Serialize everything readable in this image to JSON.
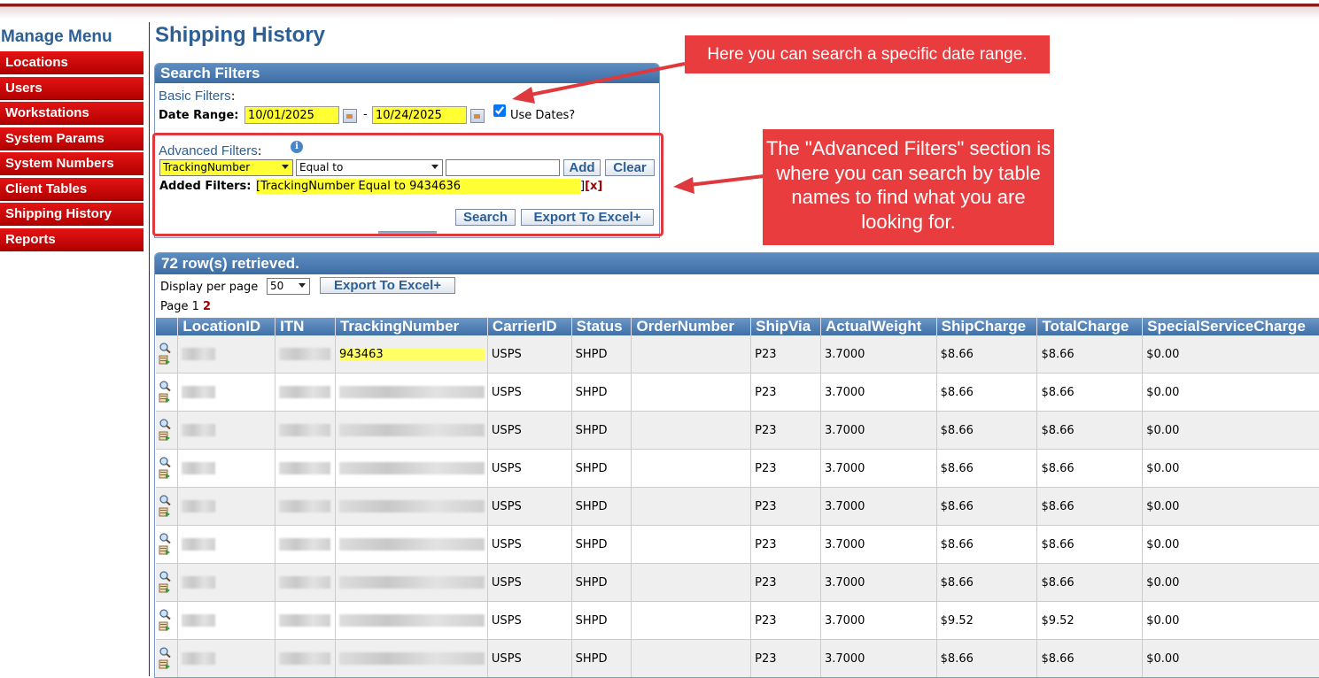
{
  "sidebar": {
    "title": "Manage Menu",
    "items": [
      {
        "label": "Locations"
      },
      {
        "label": "Users"
      },
      {
        "label": "Workstations"
      },
      {
        "label": "System Params"
      },
      {
        "label": "System Numbers"
      },
      {
        "label": "Client Tables"
      },
      {
        "label": "Shipping History"
      },
      {
        "label": "Reports"
      }
    ]
  },
  "page": {
    "title": "Shipping History"
  },
  "filters": {
    "header": "Search Filters",
    "basic_label": "Basic Filters",
    "colon": ":",
    "date_range_label": "Date Range:",
    "date_from": "10/01/2025",
    "date_sep": "-",
    "date_to": "10/24/2025",
    "use_dates_label": "Use Dates?",
    "use_dates_checked": true,
    "advanced_label": "Advanced Filters",
    "field_select": "TrackingNumber",
    "operator_select": "Equal to",
    "value_input": "",
    "add_label": "Add",
    "clear_label": "Clear",
    "added_filters_label": "Added Filters:",
    "added_filter_text": "[TrackingNumber Equal to 9434636",
    "added_filter_close": "]",
    "remove_label": "[x]",
    "search_label": "Search",
    "export_label": "Export To Excel+"
  },
  "callouts": {
    "date_range": "Here you can search a specific date range.",
    "advanced": "The \"Advanced Filters\" section is where you can search by table names to find what you are looking for."
  },
  "results": {
    "header": "72 row(s) retrieved.",
    "display_per_page_label": "Display per page",
    "per_page_value": "50",
    "export_label": "Export To Excel+",
    "page_label": "Page",
    "pages": [
      "1",
      "2"
    ],
    "columns": [
      "LocationID",
      "ITN",
      "TrackingNumber",
      "CarrierID",
      "Status",
      "OrderNumber",
      "ShipVia",
      "ActualWeight",
      "ShipCharge",
      "TotalCharge",
      "SpecialServiceCharge"
    ],
    "rows": [
      {
        "tracking": "943463",
        "carrier": "USPS",
        "status": "SHPD",
        "order": "",
        "shipvia": "P23",
        "weight": "3.7000",
        "ship": "$8.66",
        "total": "$8.66",
        "special": "$0.00"
      },
      {
        "tracking": "",
        "carrier": "USPS",
        "status": "SHPD",
        "order": "",
        "shipvia": "P23",
        "weight": "3.7000",
        "ship": "$8.66",
        "total": "$8.66",
        "special": "$0.00"
      },
      {
        "tracking": "",
        "carrier": "USPS",
        "status": "SHPD",
        "order": "",
        "shipvia": "P23",
        "weight": "3.7000",
        "ship": "$8.66",
        "total": "$8.66",
        "special": "$0.00"
      },
      {
        "tracking": "",
        "carrier": "USPS",
        "status": "SHPD",
        "order": "",
        "shipvia": "P23",
        "weight": "3.7000",
        "ship": "$8.66",
        "total": "$8.66",
        "special": "$0.00"
      },
      {
        "tracking": "",
        "carrier": "USPS",
        "status": "SHPD",
        "order": "",
        "shipvia": "P23",
        "weight": "3.7000",
        "ship": "$8.66",
        "total": "$8.66",
        "special": "$0.00"
      },
      {
        "tracking": "",
        "carrier": "USPS",
        "status": "SHPD",
        "order": "",
        "shipvia": "P23",
        "weight": "3.7000",
        "ship": "$8.66",
        "total": "$8.66",
        "special": "$0.00"
      },
      {
        "tracking": "",
        "carrier": "USPS",
        "status": "SHPD",
        "order": "",
        "shipvia": "P23",
        "weight": "3.7000",
        "ship": "$8.66",
        "total": "$8.66",
        "special": "$0.00"
      },
      {
        "tracking": "",
        "carrier": "USPS",
        "status": "SHPD",
        "order": "",
        "shipvia": "P23",
        "weight": "3.7000",
        "ship": "$9.52",
        "total": "$9.52",
        "special": "$0.00"
      },
      {
        "tracking": "",
        "carrier": "USPS",
        "status": "SHPD",
        "order": "",
        "shipvia": "P23",
        "weight": "3.7000",
        "ship": "$8.66",
        "total": "$8.66",
        "special": "$0.00"
      }
    ]
  },
  "icons": {
    "view": "magnifier-icon",
    "detail": "record-arrow-icon",
    "info": "info-icon",
    "calendar": "calendar-icon"
  },
  "colors": {
    "menu_red": "#c80000",
    "header_blue": "#3d6ea3",
    "title_blue": "#2c5f95",
    "highlight_yellow": "#ffff33",
    "callout_red": "#e93c3f"
  }
}
